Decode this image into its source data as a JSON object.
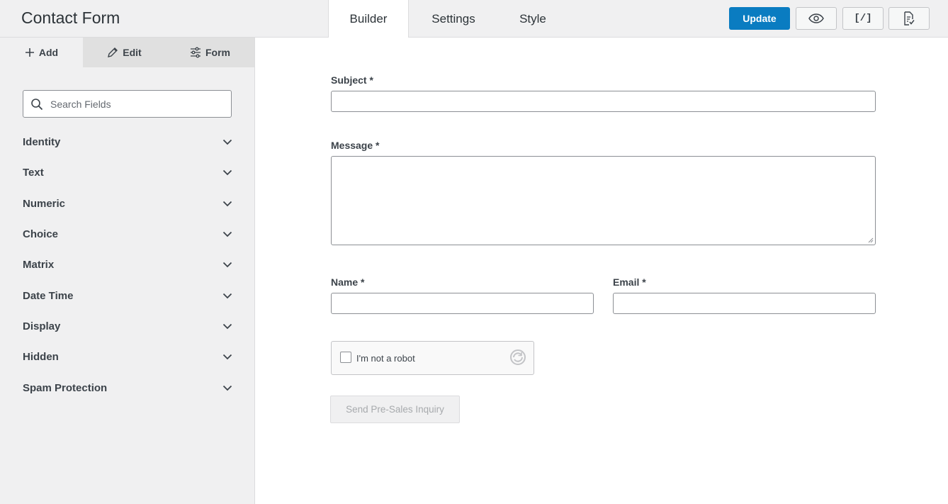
{
  "header": {
    "title": "Contact Form",
    "tabs": [
      {
        "label": "Builder",
        "active": true
      },
      {
        "label": "Settings",
        "active": false
      },
      {
        "label": "Style",
        "active": false
      }
    ],
    "update_label": "Update",
    "embed_label": "[/]",
    "accent_color": "#0a7cc1"
  },
  "sidebar": {
    "tabs": [
      {
        "label": "Add",
        "icon": "plus-icon",
        "active": true
      },
      {
        "label": "Edit",
        "icon": "pencil-icon",
        "active": false
      },
      {
        "label": "Form",
        "icon": "sliders-icon",
        "active": false
      }
    ],
    "search": {
      "placeholder": "Search Fields",
      "value": ""
    },
    "categories": [
      {
        "label": "Identity"
      },
      {
        "label": "Text"
      },
      {
        "label": "Numeric"
      },
      {
        "label": "Choice"
      },
      {
        "label": "Matrix"
      },
      {
        "label": "Date Time"
      },
      {
        "label": "Display"
      },
      {
        "label": "Hidden"
      },
      {
        "label": "Spam Protection"
      }
    ]
  },
  "form": {
    "subject_label": "Subject *",
    "message_label": "Message *",
    "name_label": "Name *",
    "email_label": "Email *",
    "captcha_label": "I'm not a robot",
    "submit_label": "Send Pre-Sales Inquiry"
  }
}
